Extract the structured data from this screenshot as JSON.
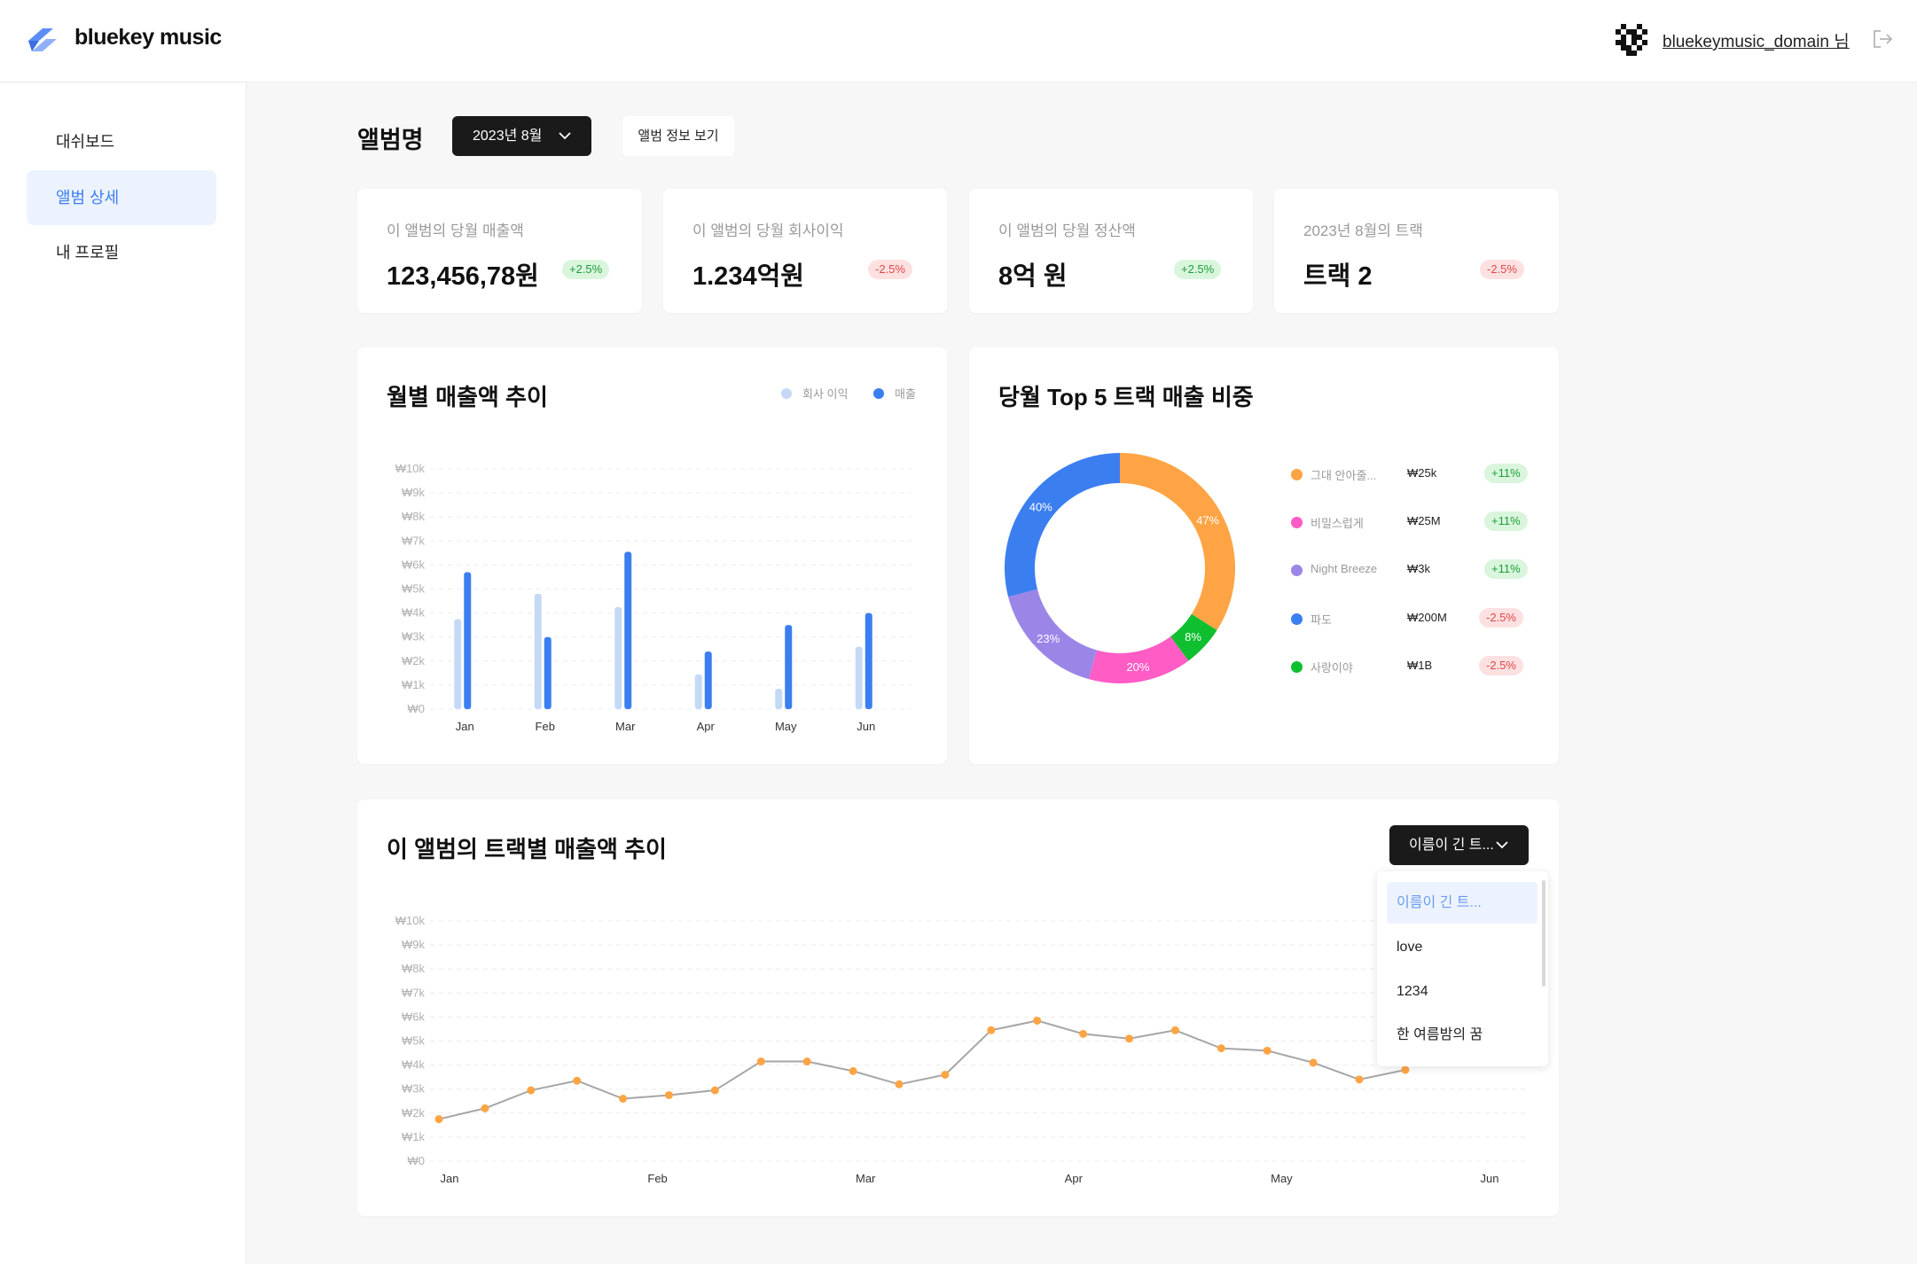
{
  "header": {
    "brand": "bluekey music",
    "user_name": "bluekeymusic_domain 님",
    "logo_icon": "bluekey-logo",
    "logout_icon": "logout-icon"
  },
  "sidebar": {
    "items": [
      {
        "label": "대쉬보드",
        "active": false
      },
      {
        "label": "앨범 상세",
        "active": true
      },
      {
        "label": "내 프로필",
        "active": false
      }
    ]
  },
  "toolbar": {
    "title": "앨범명",
    "month_select": "2023년 8월",
    "album_info_button": "앨범 정보 보기"
  },
  "stats": [
    {
      "label": "이 앨범의 당월 매출액",
      "value": "123,456,78원",
      "change": "+2.5%",
      "trend": "up"
    },
    {
      "label": "이 앨범의 당월 회사이익",
      "value": "1.234억원",
      "change": "-2.5%",
      "trend": "down"
    },
    {
      "label": "이 앨범의 당월 정산액",
      "value": "8억 원",
      "change": "+2.5%",
      "trend": "up"
    },
    {
      "label": "2023년 8월의 트랙",
      "value": "트랙 2",
      "change": "-2.5%",
      "trend": "down"
    }
  ],
  "colors": {
    "accent": "#3b7ef0",
    "light_blue": "#c5d9f6",
    "orange": "#ffa444",
    "pink": "#ff5cc6",
    "purple": "#9b86e8",
    "green": "#0fbf2f",
    "line_gray": "#a6a6a6"
  },
  "chart_data": [
    {
      "type": "bar",
      "title": "월별 매출액 추이",
      "categories": [
        "Jan",
        "Feb",
        "Mar",
        "Apr",
        "May",
        "Jun"
      ],
      "y_ticks": [
        "₩0",
        "₩1k",
        "₩2k",
        "₩3k",
        "₩4k",
        "₩5k",
        "₩6k",
        "₩7k",
        "₩8k",
        "₩9k",
        "₩10k"
      ],
      "ylim": [
        0,
        10000
      ],
      "legend_position": "top-right",
      "grid": true,
      "series": [
        {
          "name": "회사 이익",
          "color": "#c5d9f6",
          "values": [
            3750,
            4800,
            4250,
            1450,
            850,
            2600
          ]
        },
        {
          "name": "매출",
          "color": "#3b7ef0",
          "values": [
            5700,
            3000,
            6550,
            2400,
            3500,
            4000
          ]
        }
      ]
    },
    {
      "type": "pie",
      "title": "당월 Top 5 트랙 매출 비중",
      "slices": [
        {
          "name": "그대 안아줄...",
          "percent": 47,
          "amount": "₩25k",
          "change": "+11%",
          "trend": "up",
          "color": "#ffa444"
        },
        {
          "name": "비밀스럽게",
          "percent": 20,
          "amount": "₩25M",
          "change": "+11%",
          "trend": "up",
          "color": "#ff5cc6"
        },
        {
          "name": "Night Breeze",
          "percent": 23,
          "amount": "₩3k",
          "change": "+11%",
          "trend": "up",
          "color": "#9b86e8"
        },
        {
          "name": "파도",
          "percent": 40,
          "amount": "₩200M",
          "change": "-2.5%",
          "trend": "down",
          "color": "#3b7ef0"
        },
        {
          "name": "사랑이야",
          "percent": 8,
          "amount": "₩1B",
          "change": "-2.5%",
          "trend": "down",
          "color": "#0fbf2f"
        }
      ]
    },
    {
      "type": "line",
      "title": "이 앨범의 트랙별 매출액 추이",
      "x_ticks": [
        "Jan",
        "Feb",
        "Mar",
        "Apr",
        "May",
        "Jun"
      ],
      "y_ticks": [
        "₩0",
        "₩1k",
        "₩2k",
        "₩3k",
        "₩4k",
        "₩5k",
        "₩6k",
        "₩7k",
        "₩8k",
        "₩9k",
        "₩10k"
      ],
      "ylim": [
        0,
        10000
      ],
      "grid": true,
      "series": [
        {
          "color": "#a6a6a6",
          "point_color": "#ffa444",
          "values": [
            1750,
            2200,
            2950,
            3350,
            2600,
            2750,
            2950,
            4150,
            4150,
            3750,
            3200,
            3600,
            5450,
            5850,
            5300,
            5100,
            5450,
            4700,
            4600,
            4100,
            3400,
            3800
          ]
        }
      ]
    }
  ],
  "track_trend": {
    "select_label": "이름이 긴 트...",
    "dropdown_options": [
      "이름이 긴 트...",
      "love",
      "1234",
      "한 여름밤의 꿈"
    ]
  }
}
